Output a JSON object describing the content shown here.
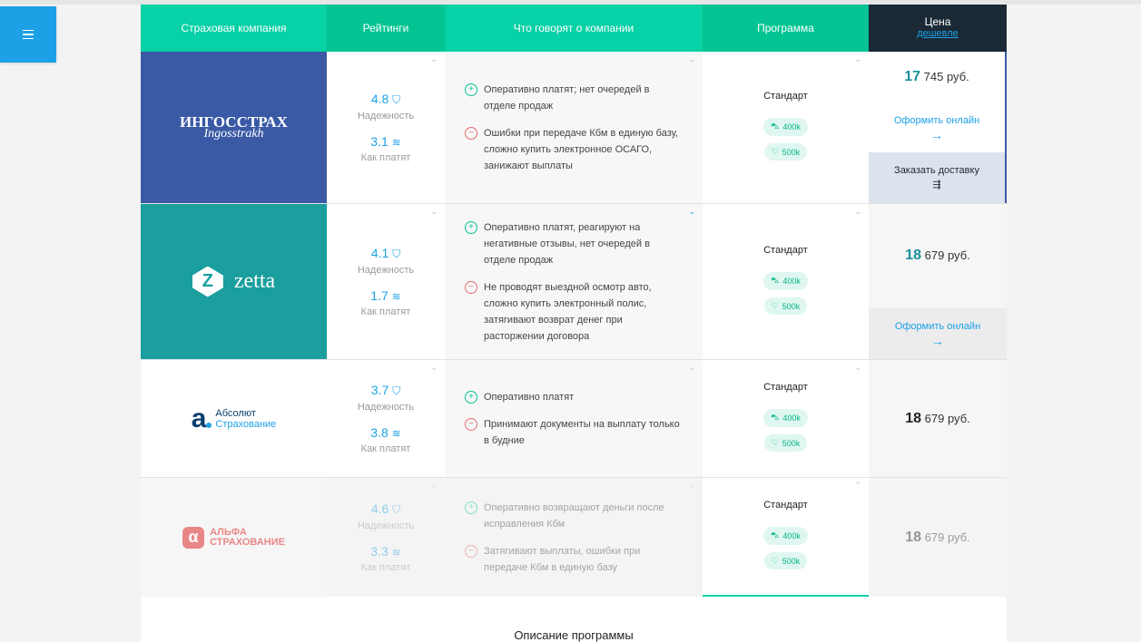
{
  "header": {
    "company": "Страховая компания",
    "ratings": "Рейтинги",
    "reviews": "Что говорят о компании",
    "program": "Программа",
    "price": "Цена",
    "price_sort": "дешевле"
  },
  "rows": [
    {
      "logo": {
        "line1": "ИНГОССТРАХ",
        "line2": "Ingosstrakh"
      },
      "rating1": "4.8",
      "rating1_label": "Надежность",
      "rating2": "3.1",
      "rating2_label": "Как платят",
      "plus": "Оперативно платят; нет очередей в отделе продаж",
      "minus": "Ошибки при передаче Кбм в единую базу, сложно купить электронное ОСАГО, занижают выплаты",
      "program": "Стандарт",
      "chip1": "400k",
      "chip2": "500k",
      "price_int": "17",
      "price_rest": "745 руб.",
      "buy_online": "Оформить онлайн",
      "order_delivery": "Заказать доставку"
    },
    {
      "logo": {
        "z": "Z",
        "name": "zetta"
      },
      "rating1": "4.1",
      "rating1_label": "Надежность",
      "rating2": "1.7",
      "rating2_label": "Как платят",
      "plus": "Оперативно платят, реагируют на негативные отзывы, нет очередей в отделе продаж",
      "minus": "Не проводят выездной осмотр авто, сложно купить электронный полис, затягивают возврат денег при расторжении договора",
      "program": "Стандарт",
      "chip1": "400k",
      "chip2": "500k",
      "price_int": "18",
      "price_rest": "679 руб.",
      "buy_online": "Оформить онлайн"
    },
    {
      "logo": {
        "a": "a",
        "line1": "Абсолют",
        "line2": "Страхование"
      },
      "rating1": "3.7",
      "rating1_label": "Надежность",
      "rating2": "3.8",
      "rating2_label": "Как платят",
      "plus": "Оперативно платят",
      "minus": "Принимают документы на выплату только в будние",
      "program": "Стандарт",
      "chip1": "400k",
      "chip2": "500k",
      "price_int": "18",
      "price_rest": "679 руб."
    },
    {
      "logo": {
        "a": "α",
        "line1": "АЛЬФА",
        "line2": "СТРАХОВАНИЕ"
      },
      "rating1": "4.6",
      "rating1_label": "Надежность",
      "rating2": "3.3",
      "rating2_label": "Как платят",
      "plus": "Оперативно возвращают деньги после исправления Кбм",
      "minus": "Затягивают выплаты, ошибки при передаче Кбм в единую базу",
      "program": "Стандарт",
      "chip1": "400k",
      "chip2": "500k",
      "price_int": "18",
      "price_rest": "679 руб."
    }
  ],
  "description_title": "Описание программы",
  "colors": {
    "accent": "#07d1a6",
    "blue": "#1da1e6",
    "dark": "#1b2936",
    "ingos": "#3a5aa6",
    "zetta": "#1a9e9e"
  }
}
